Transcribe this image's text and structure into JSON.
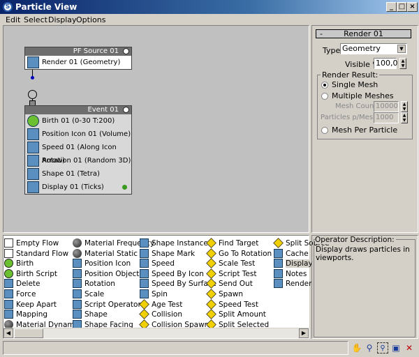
{
  "window": {
    "title": "Particle View"
  },
  "menu": [
    "Edit",
    "Select",
    "Display",
    "Options"
  ],
  "flow": {
    "source": {
      "title": "PF Source 01",
      "operators": [
        {
          "label": "Render 01 (Geometry)",
          "icon": "render-icon"
        }
      ]
    },
    "event": {
      "title": "Event 01",
      "operators": [
        {
          "label": "Birth 01 (0-30 T:200)",
          "icon": "birth-icon"
        },
        {
          "label": "Position Icon 01 (Volume)",
          "icon": "position-icon"
        },
        {
          "label": "Speed 01 (Along Icon Arrow)",
          "icon": "speed-icon"
        },
        {
          "label": "Rotation 01 (Random 3D)",
          "icon": "rotation-icon"
        },
        {
          "label": "Shape 01 (Tetra)",
          "icon": "shape-icon"
        },
        {
          "label": "Display 01 (Ticks)",
          "icon": "display-icon"
        }
      ]
    }
  },
  "panel": {
    "rollout_toggle": "-",
    "rollout_title": "Render 01",
    "type_label": "Type:",
    "type_value": "Geometry",
    "visible_label": "Visible %",
    "visible_value": "100,0",
    "group_label": "Render Result:",
    "single_mesh": "Single Mesh",
    "multiple_meshes": "Multiple Meshes",
    "mesh_count_label": "Mesh Count:",
    "mesh_count": "10000",
    "ppm_label": "Particles p/Mesh:",
    "ppm": "1000",
    "mesh_per_particle": "Mesh Per Particle",
    "selected": "Single Mesh"
  },
  "depot": {
    "columns": [
      [
        "Empty Flow",
        "Standard Flow",
        "Birth",
        "Birth Script",
        "Delete",
        "Force",
        "Keep Apart",
        "Mapping",
        "Material Dynamic"
      ],
      [
        "Material Frequency",
        "Material Static",
        "Position Icon",
        "Position Object",
        "Rotation",
        "Scale",
        "Script Operator",
        "Shape",
        "Shape Facing"
      ],
      [
        "Shape Instance",
        "Shape Mark",
        "Speed",
        "Speed By Icon",
        "Speed By Surface",
        "Spin",
        "Age Test",
        "Collision",
        "Collision Spawn"
      ],
      [
        "Find Target",
        "Go To Rotation",
        "Scale Test",
        "Script Test",
        "Send Out",
        "Spawn",
        "Speed Test",
        "Split Amount",
        "Split Selected"
      ],
      [
        "Split Source",
        "Cache",
        "Display",
        "Notes",
        "Render"
      ]
    ],
    "selected": "Display"
  },
  "description": {
    "title": "Operator Description:",
    "text": "Display draws particles in viewports."
  },
  "status_icons": [
    "pan-icon",
    "zoom-icon",
    "zoom-region-icon",
    "zoom-extents-icon",
    "no-zoom-icon"
  ],
  "colors": {
    "title_start": "#0a246a",
    "title_end": "#a6caf0",
    "canvas": "#c0c0c0",
    "node_header": "#6e6e6e",
    "test_yellow": "#f0d000",
    "active_green": "#3a9a20"
  }
}
